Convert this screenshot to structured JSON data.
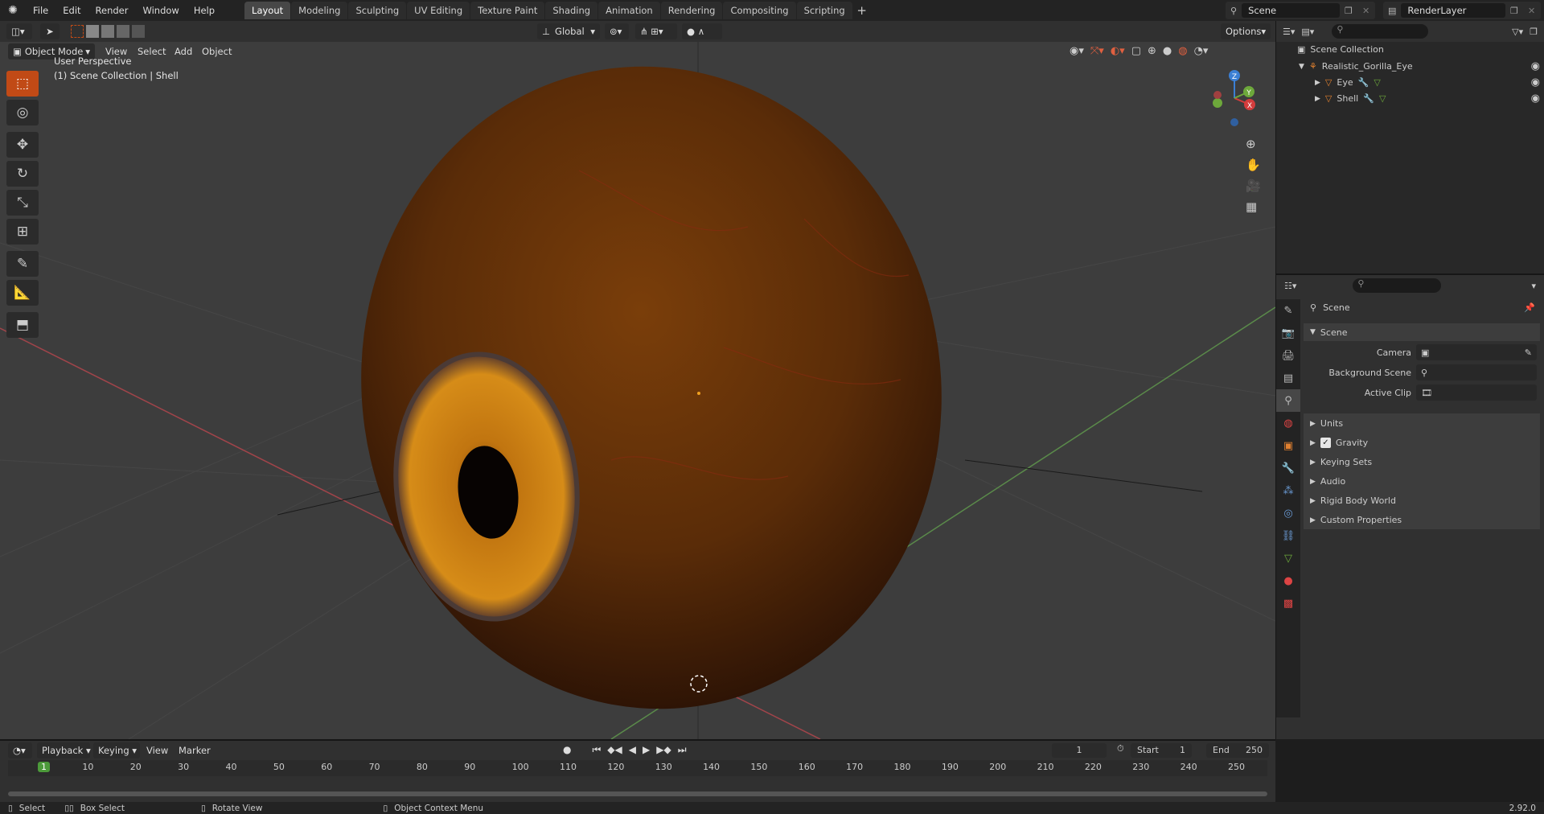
{
  "topbar": {
    "menus": [
      "File",
      "Edit",
      "Render",
      "Window",
      "Help"
    ],
    "workspaces": [
      "Layout",
      "Modeling",
      "Sculpting",
      "UV Editing",
      "Texture Paint",
      "Shading",
      "Animation",
      "Rendering",
      "Compositing",
      "Scripting"
    ],
    "active_workspace": "Layout",
    "add_tab": "+",
    "scene_name": "Scene",
    "view_layer": "RenderLayer"
  },
  "viewport_header": {
    "mode": "Object Mode",
    "menus": [
      "View",
      "Select",
      "Add",
      "Object"
    ],
    "transform_orientation": "Global",
    "options": "Options"
  },
  "viewport_overlay": {
    "perspective": "User Perspective",
    "context": "(1) Scene Collection | Shell"
  },
  "gizmo": {
    "z": "Z",
    "y": "Y",
    "x": "X"
  },
  "outliner": {
    "root": "Scene Collection",
    "collection": "Realistic_Gorilla_Eye",
    "objects": [
      "Eye",
      "Shell"
    ]
  },
  "properties": {
    "context_name": "Scene",
    "panel_title": "Scene",
    "camera_label": "Camera",
    "background_scene_label": "Background Scene",
    "active_clip_label": "Active Clip",
    "subpanels": [
      "Units",
      "Gravity",
      "Keying Sets",
      "Audio",
      "Rigid Body World",
      "Custom Properties"
    ],
    "gravity_checked": true
  },
  "timeline": {
    "menus": [
      "Playback",
      "Keying",
      "View",
      "Marker"
    ],
    "current_frame": "1",
    "start_label": "Start",
    "start": "1",
    "end_label": "End",
    "end": "250",
    "ruler": [
      "1",
      "10",
      "20",
      "30",
      "40",
      "50",
      "60",
      "70",
      "80",
      "90",
      "100",
      "110",
      "120",
      "130",
      "140",
      "150",
      "160",
      "170",
      "180",
      "190",
      "200",
      "210",
      "220",
      "230",
      "240",
      "250"
    ]
  },
  "statusbar": {
    "select": "Select",
    "box_select": "Box Select",
    "rotate_view": "Rotate View",
    "context_menu": "Object Context Menu",
    "version": "2.92.0"
  },
  "colors": {
    "accent": "#c14a16",
    "eyeball": "#6b3608",
    "iris": "#c47a12",
    "x_axis": "#d43c3c",
    "y_axis": "#6da83b",
    "z_axis": "#3b7fd4"
  }
}
